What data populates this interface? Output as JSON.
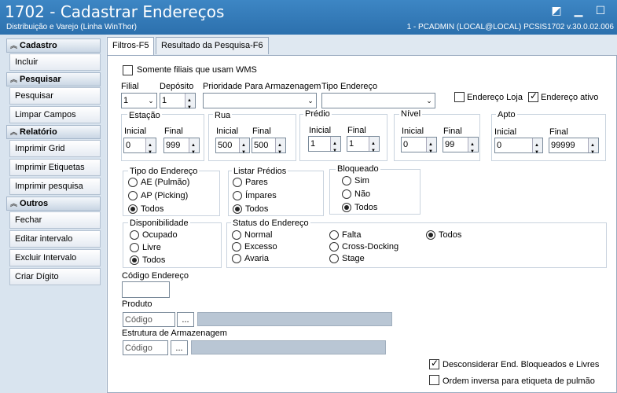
{
  "window": {
    "title": "1702 - Cadastrar Endereços",
    "subtitle": "Distribuição e Varejo (Linha WinThor)",
    "status": "1 - PCADMIN (LOCAL@LOCAL)   PCSIS1702  v.30.0.02.006"
  },
  "sidebar": {
    "cadastro": "Cadastro",
    "incluir": "Incluir",
    "pesquisar_sec": "Pesquisar",
    "pesquisar": "Pesquisar",
    "limpar": "Limpar Campos",
    "relatorio": "Relatório",
    "imp_grid": "Imprimir Grid",
    "imp_etiq": "Imprimir Etiquetas",
    "imp_pesq": "Imprimir pesquisa",
    "outros": "Outros",
    "fechar": "Fechar",
    "editar": "Editar intervalo",
    "excluir": "Excluir Intervalo",
    "criar": "Criar Dígito"
  },
  "tabs": {
    "filtros": "Filtros-F5",
    "resultado": "Resultado da Pesquisa-F6"
  },
  "form": {
    "wms": "Somente filiais que usam WMS",
    "filial_lbl": "Filial",
    "filial": "1",
    "deposito_lbl": "Depósito",
    "deposito": "1",
    "prioridade_lbl": "Prioridade Para Armazenagem",
    "tipo_end_lbl": "Tipo Endereço",
    "loja": "Endereço Loja",
    "ativo": "Endereço ativo",
    "estacao": "Estação",
    "rua": "Rua",
    "predio": "Prédio",
    "nivel": "Nível",
    "apto": "Apto",
    "inicial": "Inicial",
    "final": "Final",
    "est_i": "0",
    "est_f": "999",
    "rua_i": "500",
    "rua_f": "500",
    "pre_i": "1",
    "pre_f": "1",
    "niv_i": "0",
    "niv_f": "99",
    "apt_i": "0",
    "apt_f": "99999",
    "tipo_title": "Tipo do Endereço",
    "ae": "AE (Pulmão)",
    "ap": "AP (Picking)",
    "todos": "Todos",
    "listar_title": "Listar Prédios",
    "pares": "Pares",
    "impares": "Ímpares",
    "bloq_title": "Bloqueado",
    "sim": "Sim",
    "nao": "Não",
    "disp_title": "Disponibilidade",
    "ocupado": "Ocupado",
    "livre": "Livre",
    "status_title": "Status do Endereço",
    "normal": "Normal",
    "excesso": "Excesso",
    "avaria": "Avaria",
    "falta": "Falta",
    "cross": "Cross-Docking",
    "stage": "Stage",
    "cod_end_lbl": "Código Endereço",
    "produto_lbl": "Produto",
    "codigo_ph": "Código",
    "dots": "...",
    "estrutura_lbl": "Estrutura de Armazenagem",
    "desconsiderar": "Desconsiderar End. Bloqueados e Livres",
    "ordem": "Ordem inversa para etiqueta de pulmão"
  }
}
